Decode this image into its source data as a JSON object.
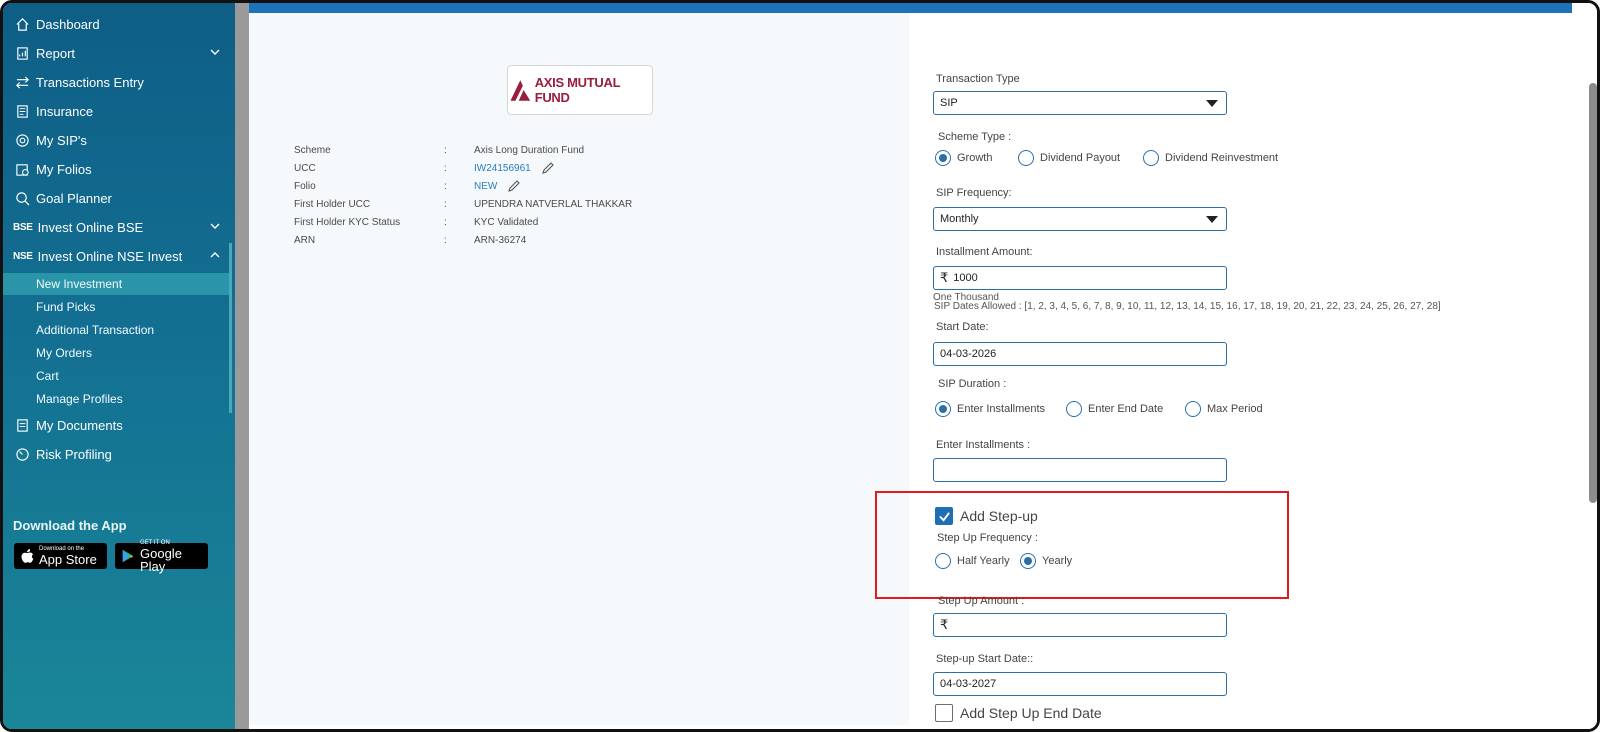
{
  "sidebar": {
    "items": [
      {
        "label": "Dashboard",
        "icon": "home-icon"
      },
      {
        "label": "Report",
        "icon": "report-icon"
      },
      {
        "label": "Transactions Entry",
        "icon": "transfer-icon"
      },
      {
        "label": "Insurance",
        "icon": "insurance-icon"
      },
      {
        "label": "My SIP's",
        "icon": "sip-icon"
      },
      {
        "label": "My Folios",
        "icon": "folio-icon"
      },
      {
        "label": "Goal Planner",
        "icon": "goal-icon"
      },
      {
        "label": "Invest Online BSE",
        "tag": "BSE"
      },
      {
        "label": "Invest Online NSE Invest",
        "tag": "NSE"
      }
    ],
    "subitems": [
      "New Investment",
      "Fund Picks",
      "Additional Transaction",
      "My Orders",
      "Cart",
      "Manage Profiles"
    ],
    "lower_items": [
      {
        "label": "My Documents",
        "icon": "document-icon"
      },
      {
        "label": "Risk Profiling",
        "icon": "gauge-icon"
      }
    ],
    "download_title": "Download the App",
    "app_store": {
      "small": "Download on the",
      "big": "App Store"
    },
    "google_play": {
      "small": "GET IT ON",
      "big": "Google Play"
    }
  },
  "fund": {
    "logo_text": "AXIS MUTUAL FUND",
    "rows": [
      {
        "label": "Scheme",
        "value": "Axis Long Duration Fund"
      },
      {
        "label": "UCC",
        "value": "IW24156961"
      },
      {
        "label": "Folio",
        "value": "NEW"
      },
      {
        "label": "First Holder UCC",
        "value": "UPENDRA NATVERLAL THAKKAR"
      },
      {
        "label": "First Holder KYC Status",
        "value": "KYC Validated"
      },
      {
        "label": "ARN",
        "value": "ARN-36274"
      }
    ],
    "colon": ":"
  },
  "form": {
    "transaction_type_label": "Transaction Type",
    "transaction_type_value": "SIP",
    "scheme_type_label": "Scheme Type :",
    "scheme_options": [
      "Growth",
      "Dividend Payout",
      "Dividend Reinvestment"
    ],
    "sip_frequency_label": "SIP Frequency:",
    "sip_frequency_value": "Monthly",
    "installment_label": "Installment Amount:",
    "currency": "₹",
    "installment_value": "1000",
    "amount_words": "One Thousand",
    "sip_dates": "SIP Dates Allowed : [1, 2, 3, 4, 5, 6, 7, 8, 9, 10, 11, 12, 13, 14, 15, 16, 17, 18, 19, 20, 21, 22, 23, 24, 25, 26, 27, 28]",
    "start_date_label": "Start Date:",
    "start_date_value": "04-03-2026",
    "duration_label": "SIP Duration :",
    "duration_options": [
      "Enter Installments",
      "Enter End Date",
      "Max Period"
    ],
    "installments_label": "Enter Installments :",
    "installments_value": "",
    "stepup_check": "Add Step-up",
    "stepup_freq_label": "Step Up Frequency :",
    "stepup_options": [
      "Half Yearly",
      "Yearly"
    ],
    "stepup_amount_label": "Step Up Amount :",
    "stepup_start_label": "Step-up Start Date::",
    "stepup_start_value": "04-03-2027",
    "stepup_end_check": "Add Step Up End Date"
  },
  "colors": {
    "accent": "#1d72b8",
    "highlight": "#e11b1b",
    "sidebar": "#136f92"
  }
}
